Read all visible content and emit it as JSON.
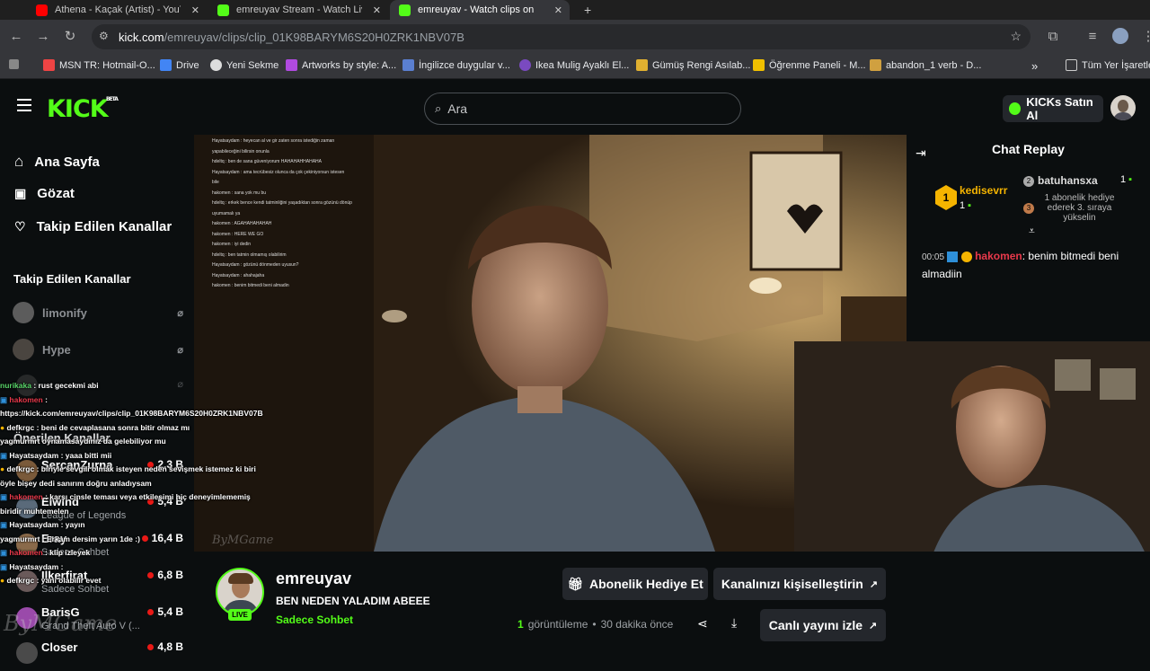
{
  "browser": {
    "tabs": [
      {
        "title": "Athena - Kaçak (Artist) - YouTube"
      },
      {
        "title": "emreuyav Stream - Watch Live"
      },
      {
        "title": "emreuyav - Watch clips on"
      }
    ],
    "url_host": "kick.com",
    "url_path": "/emreuyav/clips/clip_01K98BARYM6S20H0ZRK1NBV07B",
    "bookmarks": [
      "MSN TR: Hotmail-O...",
      "Drive",
      "Yeni Sekme",
      "Artworks by style: A...",
      "İngilizce duygular v...",
      "Ikea Mulig Ayaklı El...",
      "Gümüş Rengi Asılab...",
      "Öğrenme Paneli - M...",
      "abandon_1 verb - D..."
    ],
    "all_bookmarks": "Tüm Yer İşaretleri"
  },
  "header": {
    "logo": "KICK",
    "logo_beta": "BETA",
    "search_placeholder": "Ara",
    "kicks_button": "KICKs Satın Al"
  },
  "sidebar": {
    "nav": [
      "Ana Sayfa",
      "Gözat",
      "Takip Edilen Kanallar"
    ],
    "followed_title": "Takip Edilen Kanallar",
    "offline_channels": [
      "limonify",
      "Hype"
    ],
    "recommended_title": "Önerilen Kanallar",
    "channels": [
      {
        "name": "SercanZurna",
        "category": "",
        "viewers": "2,3 B"
      },
      {
        "name": "Elwind",
        "category": "League of Legends",
        "viewers": "5,4 B"
      },
      {
        "name": "Eray",
        "category": "Sadece Sohbet",
        "viewers": "16,4 B"
      },
      {
        "name": "Ilkerfirat",
        "category": "Sadece Sohbet",
        "viewers": "6,8 B"
      },
      {
        "name": "BarisG",
        "category": "Grand Theft Auto V (...",
        "viewers": "5,4 B"
      },
      {
        "name": "Closer",
        "category": "",
        "viewers": "4,8 B"
      }
    ]
  },
  "overlay_chat": [
    {
      "user": "nurikaka",
      "msg": "rust gecekmi abi",
      "color": "#5ad66a"
    },
    {
      "user": "hakomen",
      "msg": "",
      "color": "#e8394b"
    },
    {
      "user": "",
      "msg": "https://kick.com/emreuyav/clips/clip_01K98BARYM6S20H0ZRK1NBV07B",
      "color": "#ffffff"
    },
    {
      "user": "defkrgc",
      "msg": "beni de cevaplasana sonra bitir olmaz mı",
      "color": "#ffd24a"
    },
    {
      "user": "yagmurmrt",
      "msg": "oynamasaydınız da gelebiliyor mu",
      "color": "#ffffff"
    },
    {
      "user": "Hayatsaydam",
      "msg": "yaaa bitti mii",
      "color": "#ffd24a"
    },
    {
      "user": "defkrgc",
      "msg": "biriyle sevgili olmak isteyen neden sevişmek istemez ki biri",
      "color": "#ffd24a"
    },
    {
      "user": "",
      "msg": "öyle bişey dedi sanırım doğru anladıysam",
      "color": "#ffffff"
    },
    {
      "user": "hakomen",
      "msg": "karşı cinsle teması veya etkileşimi hiç deneyimlememiş",
      "color": "#e8394b"
    },
    {
      "user": "",
      "msg": "biridir muhtemelen",
      "color": "#ffffff"
    },
    {
      "user": "Hayatsaydam",
      "msg": "yayın",
      "color": "#ffd24a"
    },
    {
      "user": "yagmurmrt",
      "msg": "Erkam dersim yarın 1de :)",
      "color": "#ffffff"
    },
    {
      "user": "hakomen",
      "msg": "klip izleyek",
      "color": "#e8394b"
    },
    {
      "user": "Hayatsaydam",
      "msg": "",
      "color": "#ffd24a"
    },
    {
      "user": "defkrgc",
      "msg": "yani olabilir evet",
      "color": "#ffd24a"
    }
  ],
  "video_top_chat": [
    "Hayatsaydam : heyecan al ve gir zaten sonra istediğin zaman",
    "yapabileceğini bilirsin onunla",
    "hdeltq : ben de sana güveniyorum HAHAHAHHAHAHA",
    "Hayatsaydam : ama tecrübesiz olunca da çok çekiniyorsun istesen",
    "bile",
    "hakomen : sana yok mu bu",
    "hdeltq : erkek bence kendi tatminliğini yaşadıktan sonra gözünü dönüp",
    "uyumamalı ya",
    "hakomen : AGAHAHAHAHAH",
    "hakomen : HERE WE GO",
    "hakomen : iyi dedin",
    "hdeltq : ben tatmin olmamış olabilirim",
    "Hayatsaydam : gözünü dönmeden uyusun?",
    "Hayatsaydam : ahahajaha",
    "hakomen : benim bitmedi beni almadin"
  ],
  "chat_replay": {
    "title": "Chat Replay",
    "top_gifter": {
      "name": "kedisevrr",
      "count": "1",
      "rank": "1"
    },
    "second": {
      "name": "batuhansxa",
      "count": "1",
      "rank": "2"
    },
    "gift_note": "1 abonelik hediye ederek 3. sıraya yükselin",
    "third_rank": "3",
    "messages": [
      {
        "time": "00:05",
        "user": "hakomen",
        "text": "benim bitmedi beni almadiin"
      }
    ]
  },
  "channel": {
    "name": "emreuyav",
    "title": "BEN NEDEN YALADIM ABEEE",
    "category": "Sadece Sohbet",
    "live": "LIVE",
    "views_count": "1",
    "views_label": "görüntüleme",
    "time_ago": "30 dakika önce"
  },
  "actions": {
    "gift_sub": "Abonelik Hediye Et",
    "customize": "Kanalınızı kişiselleştirin",
    "watch_live": "Canlı yayını izle"
  },
  "watermark": "ByMGame",
  "colors": {
    "brand": "#53fc18",
    "bg": "#0b0e0f",
    "button": "#24272c"
  }
}
